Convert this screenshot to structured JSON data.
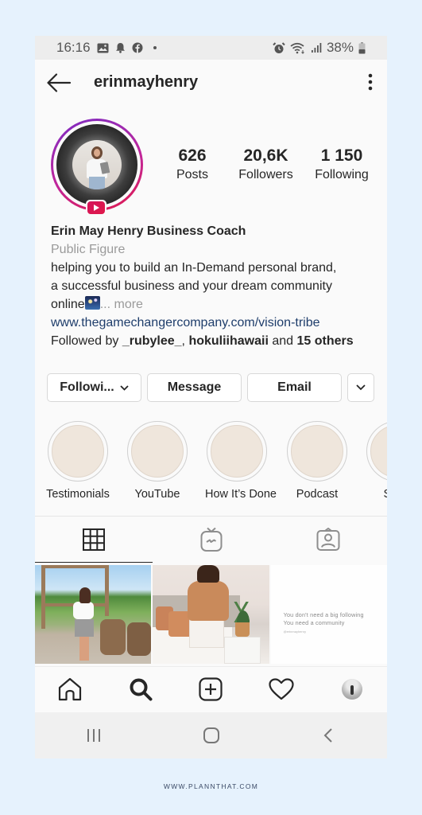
{
  "status_bar": {
    "time": "16:16",
    "left_icons": [
      "gallery-icon",
      "bell-icon",
      "facebook-icon",
      "dot-icon"
    ],
    "right_icons": [
      "alarm-icon",
      "wifi-icon",
      "signal-icon"
    ],
    "battery": "38%"
  },
  "header": {
    "username": "erinmayhenry",
    "back_icon": "arrow-left-icon",
    "menu_icon": "kebab-menu-icon"
  },
  "profile": {
    "has_igtv_badge": true,
    "stats": [
      {
        "value": "626",
        "label": "Posts"
      },
      {
        "value": "20,6K",
        "label": "Followers"
      },
      {
        "value": "1 150",
        "label": "Following"
      }
    ],
    "name": "Erin May Henry Business Coach",
    "category": "Public Figure",
    "bio_line1": "helping you to build an In-Demand personal brand,",
    "bio_line2": "a successful business and your dream community",
    "bio_line3": "online",
    "bio_emoji": "night-sky-emoji",
    "more_label": "... more",
    "website": "www.thegamechangercompany.com/vision-tribe",
    "followed_by_prefix": "Followed by ",
    "followed_by_user1": "_rubylee_",
    "followed_by_sep": ", ",
    "followed_by_user2": "hokuliihawaii",
    "followed_by_and": " and ",
    "followed_by_others": "15 others"
  },
  "actions": {
    "following_label": "Followi...",
    "message_label": "Message",
    "email_label": "Email"
  },
  "highlights": [
    {
      "label": "Testimonials"
    },
    {
      "label": "YouTube"
    },
    {
      "label": "How It’s Done"
    },
    {
      "label": "Podcast"
    },
    {
      "label": "Simp"
    }
  ],
  "tabs": [
    {
      "name": "grid",
      "icon": "grid-icon",
      "active": true
    },
    {
      "name": "igtv",
      "icon": "igtv-icon",
      "active": false
    },
    {
      "name": "tagged",
      "icon": "tagged-icon",
      "active": false
    }
  ],
  "posts": [
    {
      "type": "photo",
      "description": "woman at vineyard with barrels"
    },
    {
      "type": "photo",
      "description": "woman in orange sweater in bedroom"
    },
    {
      "type": "quote",
      "line1": "You don't need a big following",
      "line2": "You need a community",
      "handle": "@erinmayhenry"
    }
  ],
  "bottom_nav": [
    "home-icon",
    "search-icon",
    "new-post-icon",
    "activity-heart-icon",
    "profile-avatar"
  ],
  "system_nav": [
    "recents-icon",
    "home-button-icon",
    "back-icon"
  ],
  "footer": {
    "text": "WWW.PLANNTHAT.COM"
  }
}
